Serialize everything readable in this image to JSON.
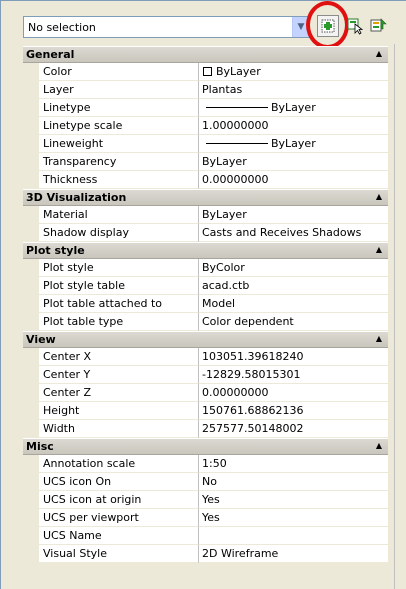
{
  "toolbar": {
    "selection_value": "No selection",
    "quick_select_icon": "quick-select-icon",
    "pick_icon": "select-objects-icon",
    "toggle_icon": "toggle-pickadd-icon"
  },
  "sections": [
    {
      "title": "General",
      "rows": [
        {
          "name": "Color",
          "value": "ByLayer",
          "kind": "color"
        },
        {
          "name": "Layer",
          "value": "Plantas"
        },
        {
          "name": "Linetype",
          "value": "ByLayer",
          "kind": "line"
        },
        {
          "name": "Linetype scale",
          "value": "1.00000000"
        },
        {
          "name": "Lineweight",
          "value": "ByLayer",
          "kind": "line"
        },
        {
          "name": "Transparency",
          "value": "ByLayer"
        },
        {
          "name": "Thickness",
          "value": "0.00000000"
        }
      ]
    },
    {
      "title": "3D Visualization",
      "rows": [
        {
          "name": "Material",
          "value": "ByLayer"
        },
        {
          "name": "Shadow display",
          "value": "Casts and Receives Shadows"
        }
      ]
    },
    {
      "title": "Plot style",
      "rows": [
        {
          "name": "Plot style",
          "value": "ByColor"
        },
        {
          "name": "Plot style table",
          "value": "acad.ctb"
        },
        {
          "name": "Plot table attached to",
          "value": "Model"
        },
        {
          "name": "Plot table type",
          "value": "Color dependent"
        }
      ]
    },
    {
      "title": "View",
      "rows": [
        {
          "name": "Center X",
          "value": "103051.39618240"
        },
        {
          "name": "Center Y",
          "value": "-12829.58015301"
        },
        {
          "name": "Center Z",
          "value": "0.00000000"
        },
        {
          "name": "Height",
          "value": "150761.68862136"
        },
        {
          "name": "Width",
          "value": "257577.50148002"
        }
      ]
    },
    {
      "title": "Misc",
      "rows": [
        {
          "name": "Annotation scale",
          "value": "1:50"
        },
        {
          "name": "UCS icon On",
          "value": "No"
        },
        {
          "name": "UCS icon at origin",
          "value": "Yes"
        },
        {
          "name": "UCS per viewport",
          "value": "Yes"
        },
        {
          "name": "UCS Name",
          "value": ""
        },
        {
          "name": "Visual Style",
          "value": "2D Wireframe"
        }
      ]
    }
  ],
  "colors": {
    "highlight_ring": "#e01010",
    "section_header": "#d6d3ce",
    "panel_background": "#ece9d8"
  }
}
